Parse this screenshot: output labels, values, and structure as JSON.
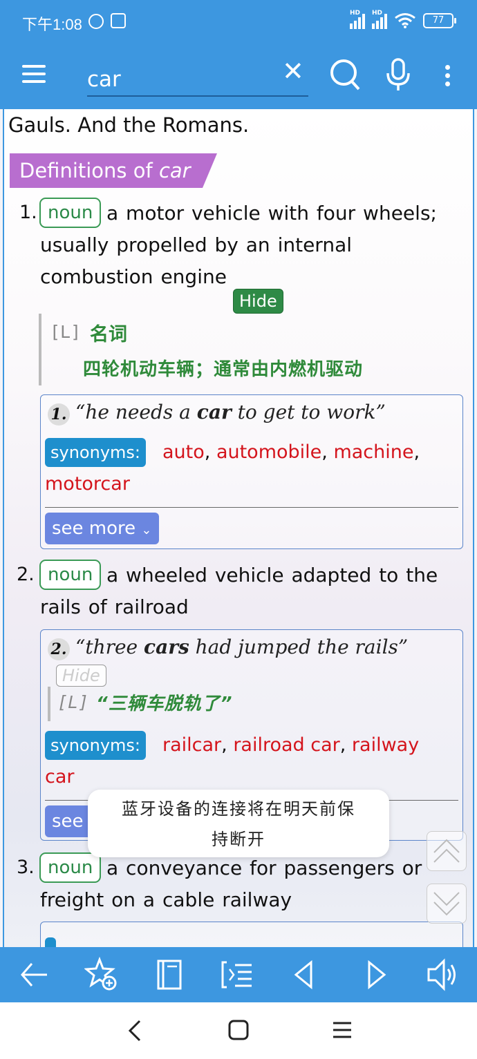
{
  "status_bar": {
    "time": "下午1:08",
    "battery": "77",
    "network_labels": [
      "HD",
      "HD"
    ]
  },
  "toolbar": {
    "search_value": "car",
    "menu_icon": "hamburger-menu-icon",
    "clear_icon": "close-icon",
    "search_icon": "search-icon",
    "mic_icon": "microphone-icon",
    "more_icon": "more-vertical-icon"
  },
  "content": {
    "previous_text": "Gauls. And the Romans.",
    "definitions_header": "Definitions of",
    "definitions_word": "car",
    "definitions": [
      {
        "number": "1.",
        "pos": "noun",
        "gloss_lines": [
          "a motor vehicle with four wheels;",
          "usually propelled by an internal",
          "combustion engine"
        ],
        "hide_label": "Hide",
        "translation_tag": "[L]",
        "translation_pos": "名词",
        "translation_text": "四轮机动车辆；通常由内燃机驱动",
        "example_number": "1.",
        "example_before": "“he needs a ",
        "example_bold": "car",
        "example_after": " to get to work”",
        "synonyms_label": "synonyms:",
        "synonyms": [
          "auto",
          "automobile",
          "machine",
          "motorcar"
        ],
        "see_more_label": "see more"
      },
      {
        "number": "2.",
        "pos": "noun",
        "gloss_lines": [
          "a wheeled vehicle adapted to the",
          "rails of railroad"
        ],
        "example_number": "2.",
        "example_before": "“three ",
        "example_bold": "cars",
        "example_after": " had jumped the rails”",
        "hide_label": "Hide",
        "translation_tag": "[L]",
        "translation_text": "“三辆车脱轨了”",
        "synonyms_label": "synonyms:",
        "synonyms": [
          "railcar",
          "railroad car",
          "railway car"
        ],
        "see_more_label": "see more"
      },
      {
        "number": "3.",
        "pos": "noun",
        "gloss_lines": [
          "a conveyance for passengers or",
          "freight on a cable railway"
        ]
      }
    ]
  },
  "toast": {
    "lines": [
      "蓝牙设备的连接将在明天前保",
      "持断开"
    ]
  },
  "bottom_bar": {
    "icons": [
      "back-arrow-icon",
      "add-favorite-icon",
      "book-icon",
      "list-icon",
      "previous-icon",
      "next-icon",
      "speaker-icon"
    ]
  },
  "nav_bar": {
    "icons": [
      "nav-back-icon",
      "nav-home-icon",
      "nav-menu-icon"
    ]
  }
}
